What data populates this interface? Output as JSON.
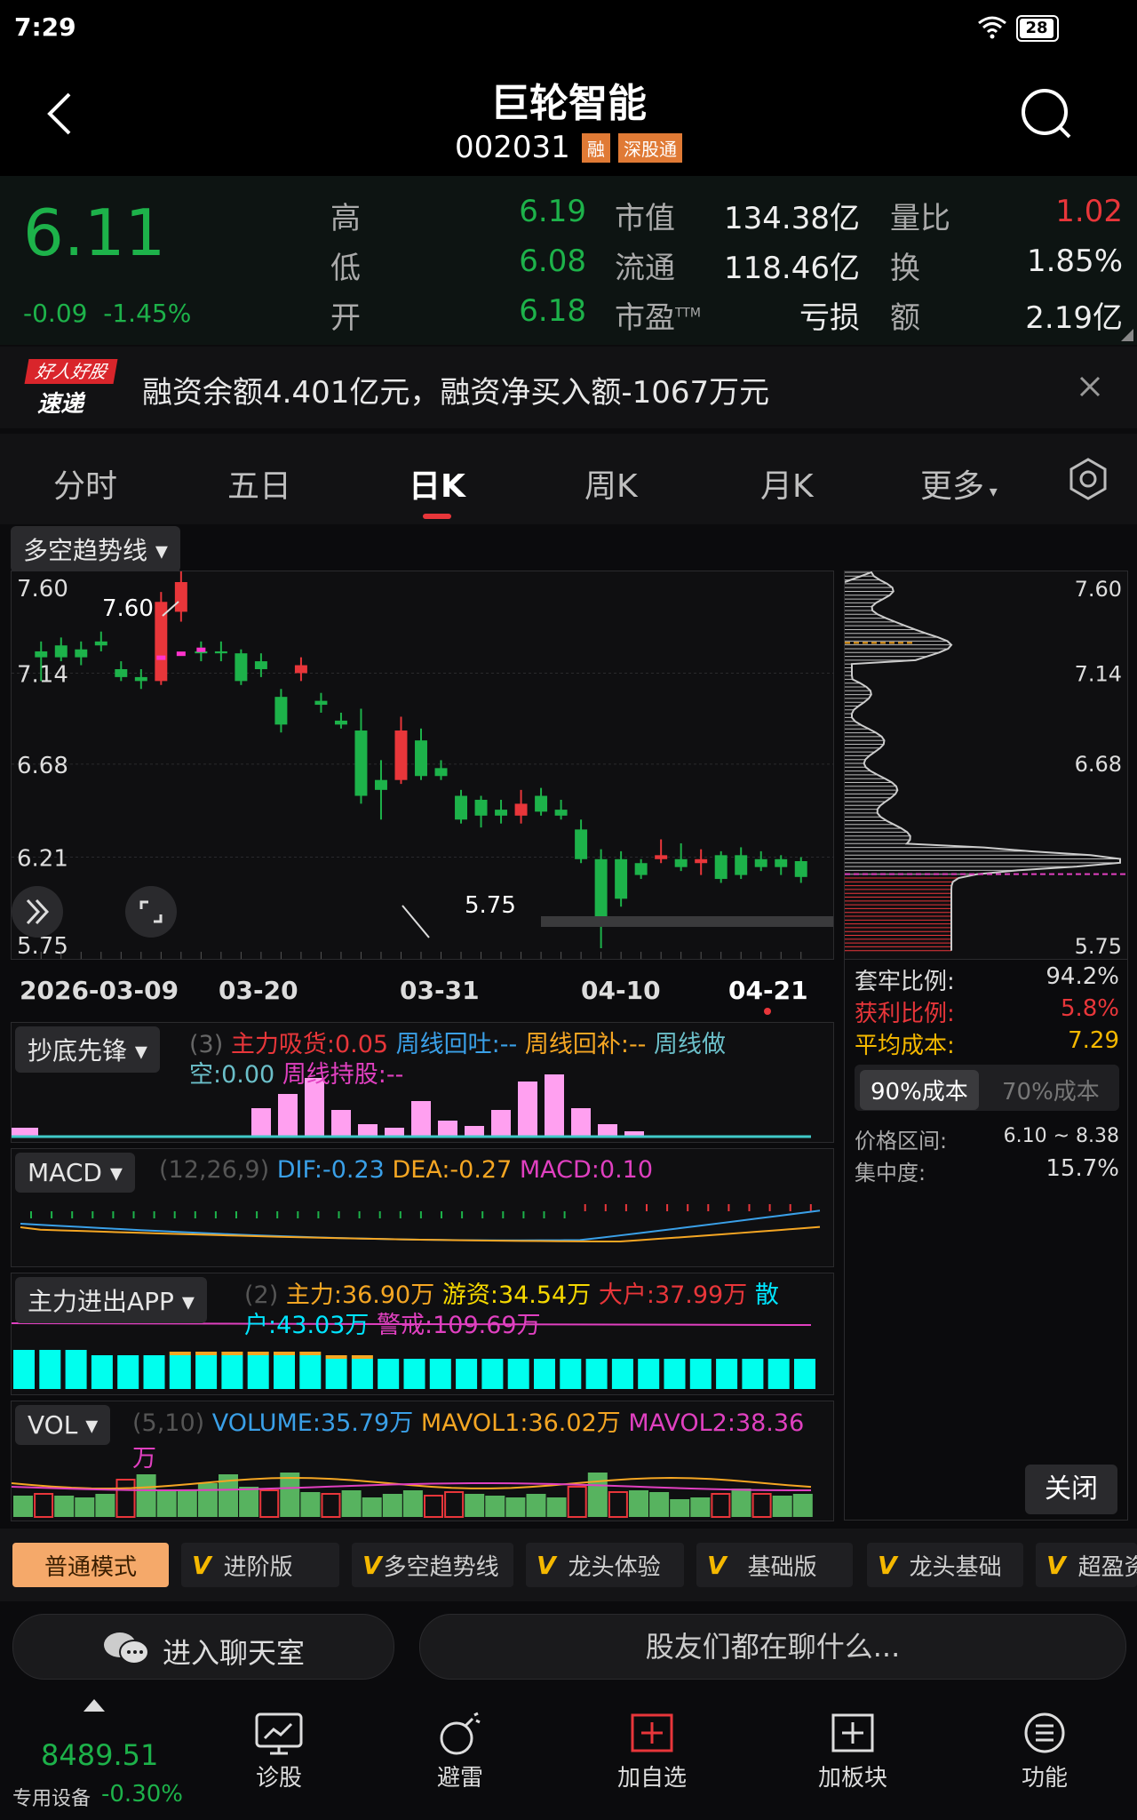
{
  "status_bar": {
    "time": "7:29",
    "battery": "28"
  },
  "header": {
    "title": "巨轮智能",
    "code": "002031",
    "badge_margin": "融",
    "badge_connect": "深股通"
  },
  "quote": {
    "price": "6.11",
    "change": "-0.09",
    "change_pct": "-1.45%",
    "high_label": "高",
    "high": "6.19",
    "low_label": "低",
    "low": "6.08",
    "open_label": "开",
    "open": "6.18",
    "mcap_label": "市值",
    "mcap": "134.38亿",
    "float_label": "流通",
    "float": "118.46亿",
    "pe_label": "市盈",
    "pe_sup": "TTM",
    "pe": "亏损",
    "vr_label": "量比",
    "vr": "1.02",
    "turnover_label": "换",
    "turnover": "1.85%",
    "amount_label": "额",
    "amount": "2.19亿"
  },
  "news": {
    "logo_top": "好人好股",
    "logo_bottom": "速递",
    "text": "融资余额4.401亿元，融资净买入额-1067万元"
  },
  "tabs": [
    "分时",
    "五日",
    "日K",
    "周K",
    "月K",
    "更多"
  ],
  "active_tab": "日K",
  "indicator_select": "多空趋势线",
  "kline": {
    "price_ticks": [
      "7.60",
      "7.14",
      "6.68",
      "6.21",
      "5.75"
    ],
    "date_ticks": [
      "2026-03-09",
      "03-20",
      "03-31",
      "04-10",
      "04-21"
    ],
    "high_marker": "7.60",
    "low_marker": "5.75"
  },
  "chips": {
    "ticks": [
      "7.60",
      "7.14",
      "6.68",
      "5.75"
    ],
    "trapped_label": "套牢比例:",
    "trapped": "94.2%",
    "profit_label": "获利比例:",
    "profit": "5.8%",
    "avg_label": "平均成本:",
    "avg": "7.29",
    "tab_90": "90%成本",
    "tab_70": "70%成本",
    "range_label": "价格区间:",
    "range": "6.10 ~ 8.38",
    "conc_label": "集中度:",
    "conc": "15.7%",
    "close_button": "关闭"
  },
  "ind1": {
    "select": "抄底先锋",
    "param": "(3)",
    "v1": "主力吸货:0.05",
    "v2": "周线回吐:--",
    "v3": "周线回补:--",
    "v4": "周线做",
    "v4b": "空:0.00",
    "v5": "周线持股:--"
  },
  "macd": {
    "select": "MACD",
    "param": "(12,26,9)",
    "dif": "DIF:-0.23",
    "dea": "DEA:-0.27",
    "macd": "MACD:0.10"
  },
  "flow": {
    "select": "主力进出APP",
    "param": "(2)",
    "main": "主力:36.90万",
    "hot": "游资:34.54万",
    "big": "大户:37.99万",
    "retail_a": "散",
    "retail_b": "户:43.03万",
    "warn": "警戒:109.69万"
  },
  "vol": {
    "select": "VOL",
    "param": "(5,10)",
    "volume": "VOLUME:35.79万",
    "mavol1": "MAVOL1:36.02万",
    "mavol2": "MAVOL2:38.36",
    "mavol2b": "万"
  },
  "modes": [
    "普通模式",
    "进阶版",
    "多空趋势线",
    "龙头体验",
    "基础版",
    "龙头基础",
    "超盈资"
  ],
  "chat": {
    "enter": "进入聊天室",
    "prompt": "股友们都在聊什么..."
  },
  "index": {
    "value": "8489.51",
    "label": "专用设备",
    "change": "-0.30%"
  },
  "bottom_nav": [
    "诊股",
    "避雷",
    "加自选",
    "加板块",
    "功能"
  ],
  "colors": {
    "up": "#e8363a",
    "down": "#1db24a",
    "accent": "#e8363a",
    "orange": "#f5a623"
  }
}
